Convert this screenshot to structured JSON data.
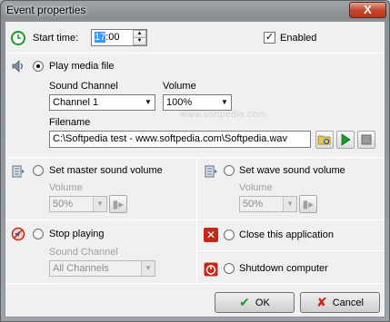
{
  "window": {
    "title": "Event properties",
    "close_glyph": "X"
  },
  "start_time": {
    "label": "Start time:",
    "hours": "17",
    "rest": ":00",
    "icon": "clock-icon"
  },
  "enabled": {
    "label": "Enabled",
    "checked": true,
    "check_glyph": "✓"
  },
  "play_media": {
    "label": "Play media file",
    "selected": true,
    "sound_channel_label": "Sound Channel",
    "sound_channel_value": "Channel 1",
    "volume_label": "Volume",
    "volume_value": "100%",
    "filename_label": "Filename",
    "filename_value": "C:\\Softpedia test - www.softpedia.com\\Softpedia.wav",
    "icon": "speaker-icon"
  },
  "master_volume": {
    "label": "Set master sound volume",
    "volume_label": "Volume",
    "volume_value": "50%",
    "icon": "volume-control-icon"
  },
  "wave_volume": {
    "label": "Set wave sound volume",
    "volume_label": "Volume",
    "volume_value": "50%",
    "icon": "volume-control-icon"
  },
  "stop_playing": {
    "label": "Stop playing",
    "sound_channel_label": "Sound Channel",
    "sound_channel_value": "All Channels",
    "icon": "stop-sound-icon"
  },
  "close_app": {
    "label": "Close this application",
    "icon": "close-app-icon"
  },
  "shutdown": {
    "label": "Shutdown computer",
    "icon": "power-icon"
  },
  "buttons": {
    "ok_label": "OK",
    "cancel_label": "Cancel"
  },
  "watermark": "www.softpedia.com",
  "colors": {
    "accent_green": "#1e9a2c",
    "accent_red": "#c8261a",
    "selection_blue": "#3399ff"
  }
}
